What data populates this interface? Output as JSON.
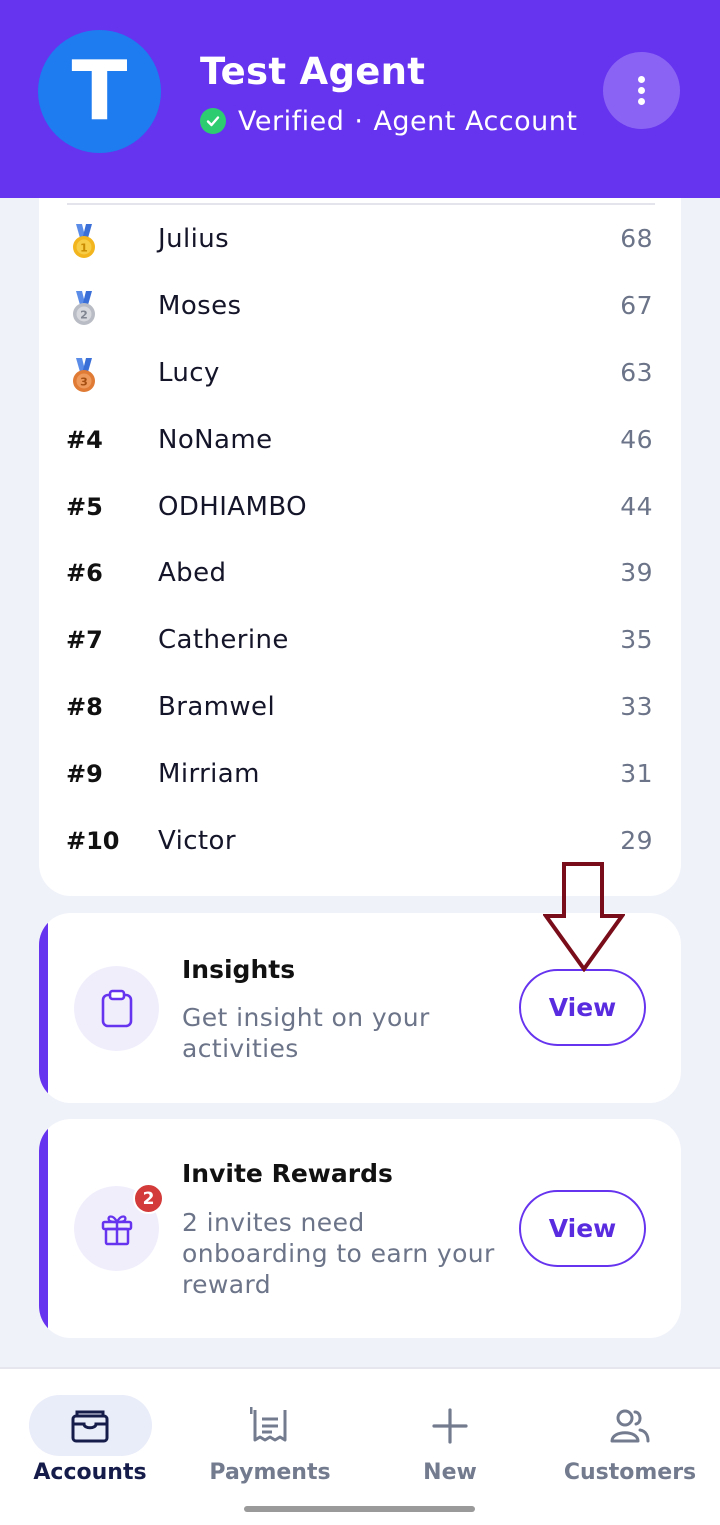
{
  "colors": {
    "primary": "#6633ee",
    "avatar": "#1e7bf0",
    "verified": "#2ecc71",
    "badge": "#d33a3a",
    "arrow": "#7a0d1a"
  },
  "header": {
    "avatar_letter": "T",
    "user_name": "Test Agent",
    "verified_label": "Verified",
    "separator": "·",
    "account_type": "Agent Account"
  },
  "leaderboard": {
    "rows": [
      {
        "rank": "",
        "medal": "gold-medal-icon",
        "name": "Julius",
        "score": "68"
      },
      {
        "rank": "",
        "medal": "silver-medal-icon",
        "name": "Moses",
        "score": "67"
      },
      {
        "rank": "",
        "medal": "bronze-medal-icon",
        "name": "Lucy",
        "score": "63"
      },
      {
        "rank": "#4",
        "name": "NoName",
        "score": "46"
      },
      {
        "rank": "#5",
        "name": "ODHIAMBO",
        "score": "44"
      },
      {
        "rank": "#6",
        "name": "Abed",
        "score": "39"
      },
      {
        "rank": "#7",
        "name": "Catherine",
        "score": "35"
      },
      {
        "rank": "#8",
        "name": "Bramwel",
        "score": "33"
      },
      {
        "rank": "#9",
        "name": "Mirriam",
        "score": "31"
      },
      {
        "rank": "#10",
        "name": "Victor",
        "score": "29"
      }
    ]
  },
  "insights_card": {
    "icon": "clipboard-icon",
    "title": "Insights",
    "description": "Get insight on your activities",
    "button_label": "View"
  },
  "invite_card": {
    "icon": "gift-icon",
    "badge_count": "2",
    "title": "Invite Rewards",
    "description": "2 invites need onboarding to earn your reward",
    "button_label": "View"
  },
  "bottom_nav": {
    "items": [
      {
        "label": "Accounts",
        "icon": "wallet-icon",
        "active": true
      },
      {
        "label": "Payments",
        "icon": "receipt-icon",
        "active": false
      },
      {
        "label": "New",
        "icon": "plus-icon",
        "active": false
      },
      {
        "label": "Customers",
        "icon": "users-icon",
        "active": false
      }
    ]
  }
}
